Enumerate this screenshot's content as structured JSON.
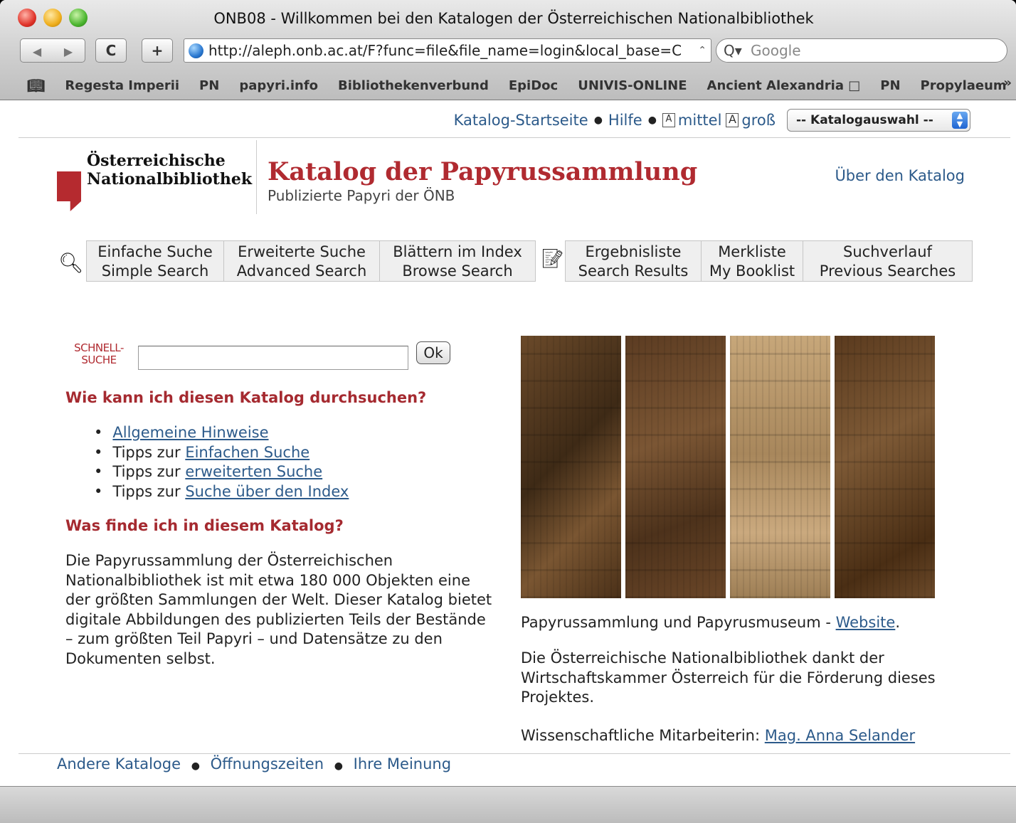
{
  "window": {
    "title": "ONB08 - Willkommen bei den Katalogen der Österreichischen Nationalbibliothek"
  },
  "toolbar": {
    "back_icon": "◀",
    "forward_icon": "▶",
    "reload_icon": "C",
    "add_bookmark_icon": "+",
    "url": "http://aleph.onb.ac.at/F?func=file&file_name=login&local_base=C",
    "search_placeholder": "Google"
  },
  "bookmarks": [
    "Regesta Imperii",
    "PN",
    "papyri.info",
    "Bibliothekenverbund",
    "EpiDoc",
    "UNIVIS-ONLINE",
    "Ancient Alexandria □",
    "PN",
    "Propylaeum"
  ],
  "toplinks": {
    "home": "Katalog-Startseite",
    "help": "Hilfe",
    "font_medium_glyph": "A",
    "font_medium": "mittel",
    "font_large_glyph": "A",
    "font_large": "groß",
    "catalog_select": "-- Katalogauswahl --"
  },
  "header": {
    "logo_line1": "Österreichische",
    "logo_line2": "Nationalbibliothek",
    "title": "Katalog der Papyrussammlung",
    "subtitle": "Publizierte Papyri der ÖNB",
    "about": "Über den Katalog"
  },
  "tabs": [
    {
      "de": "Einfache Suche",
      "en": "Simple Search"
    },
    {
      "de": "Erweiterte Suche",
      "en": "Advanced Search"
    },
    {
      "de": "Blättern im Index",
      "en": "Browse Search"
    },
    {
      "de": "Ergebnisliste",
      "en": "Search Results"
    },
    {
      "de": "Merkliste",
      "en": "My Booklist"
    },
    {
      "de": "Suchverlauf",
      "en": "Previous Searches"
    }
  ],
  "quick_search": {
    "label_line1": "SCHNELL-",
    "label_line2": "SUCHE",
    "value": "",
    "ok": "Ok"
  },
  "help_section": {
    "heading": "Wie kann ich diesen Katalog durchsuchen?",
    "items": [
      {
        "prefix": "",
        "link": "Allgemeine Hinweise"
      },
      {
        "prefix": "Tipps zur ",
        "link": "Einfachen Suche"
      },
      {
        "prefix": "Tipps zur ",
        "link": "erweiterten Suche"
      },
      {
        "prefix": "Tipps zur ",
        "link": "Suche über den Index"
      }
    ]
  },
  "about_section": {
    "heading": "Was finde ich in diesem Katalog?",
    "text": "Die Papyrussammlung der Österreichischen Nationalbibliothek ist mit etwa 180 000 Objekten eine der größten Sammlungen der Welt. Dieser Katalog bietet digitale Abbildungen des publizierten Teils der Bestände – zum größten Teil Papyri – und Datensätze zu den Dokumenten selbst."
  },
  "right_column": {
    "caption_text": "Papyrussammlung und Papyrusmuseum - ",
    "caption_link": "Website",
    "caption_end": ".",
    "thanks": "Die Österreichische Nationalbibliothek dankt der Wirtschaftskammer Österreich für die Förderung dieses Projektes.",
    "staff_label": "Wissenschaftliche Mitarbeiterin: ",
    "staff_name": "Mag. Anna Selander"
  },
  "footer": {
    "other": "Andere Kataloge",
    "hours": "Öffnungszeiten",
    "feedback": "Ihre Meinung"
  }
}
